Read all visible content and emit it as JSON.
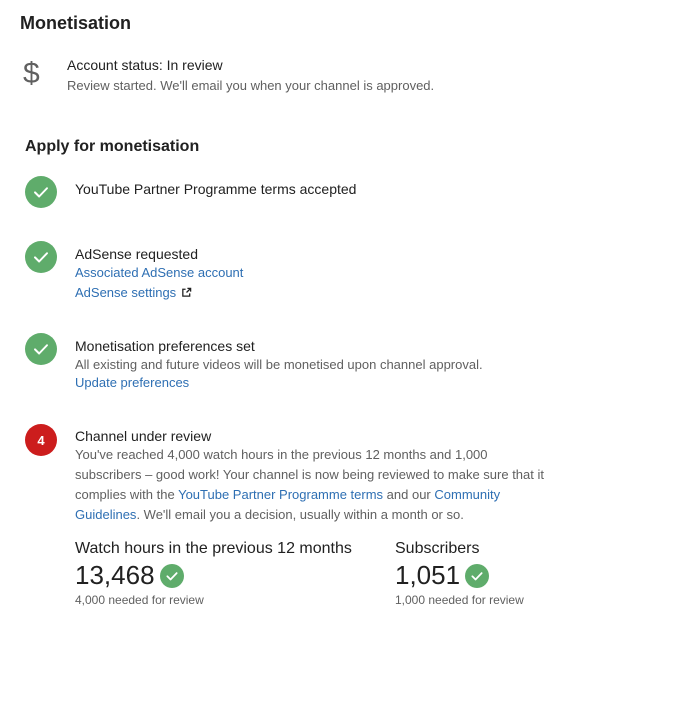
{
  "page": {
    "title": "Monetisation"
  },
  "account_status": {
    "icon": "dollar-icon",
    "title": "Account status: In review",
    "subtitle": "Review started. We'll email you when your channel is approved."
  },
  "apply": {
    "title": "Apply for monetisation",
    "steps": [
      {
        "status": "done",
        "title": "YouTube Partner Programme terms accepted"
      },
      {
        "status": "done",
        "title": "AdSense requested",
        "links": [
          "Associated AdSense account",
          "AdSense settings"
        ]
      },
      {
        "status": "done",
        "title": "Monetisation preferences set",
        "text": "All existing and future videos will be monetised upon channel approval.",
        "links": [
          "Update preferences"
        ]
      },
      {
        "status": "in_progress",
        "number": "4",
        "title": "Channel under review",
        "text_part1": "You've reached 4,000 watch hours in the previous 12 months and 1,000 subscribers – good work! Your channel is now being reviewed to make sure that it complies with the ",
        "link1": "YouTube Partner Programme terms",
        "text_part2": " and our ",
        "link2": "Community Guidelines",
        "text_part3": ". We'll email you a decision, usually within a month or so."
      }
    ]
  },
  "metrics": {
    "watch_hours": {
      "label": "Watch hours in the previous 12 months",
      "value": "13,468",
      "note": "4,000 needed for review"
    },
    "subscribers": {
      "label": "Subscribers",
      "value": "1,051",
      "note": "1,000 needed for review"
    }
  },
  "colors": {
    "check_green": "#5fac6b",
    "alert_red": "#cc1d1d",
    "link_blue": "#2e6fb3",
    "secondary_text": "#606060"
  }
}
